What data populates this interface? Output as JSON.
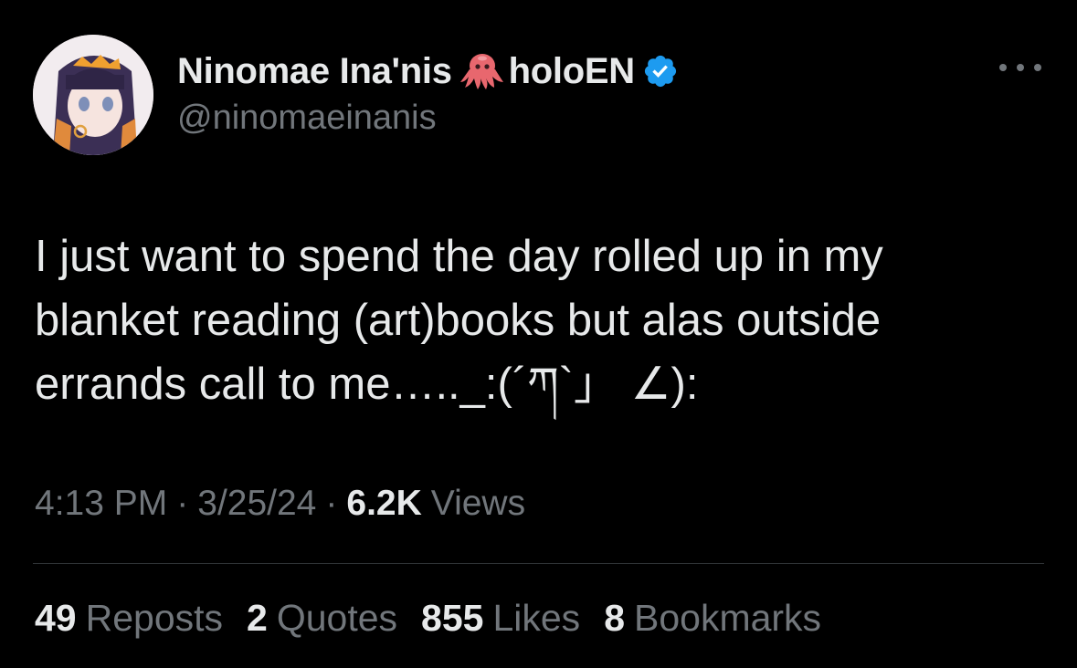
{
  "author": {
    "display_name": "Ninomae Ina'nis",
    "display_suffix": "holoEN",
    "handle": "@ninomaeinanis",
    "badge_icon": "octopus-icon",
    "verified": true,
    "verified_color": "#1d9bf0"
  },
  "tweet": {
    "lines": [
      "I just want to spend the day rolled up in my",
      "blanket reading (art)books but alas outside",
      "errands call to me….._:(´ཀ`」 ∠):"
    ]
  },
  "meta": {
    "time": "4:13 PM",
    "separator": "·",
    "date": "3/25/24",
    "views_count": "6.2K",
    "views_label": "Views"
  },
  "stats": {
    "reposts": {
      "count": "49",
      "label": "Reposts"
    },
    "quotes": {
      "count": "2",
      "label": "Quotes"
    },
    "likes": {
      "count": "855",
      "label": "Likes"
    },
    "bookmarks": {
      "count": "8",
      "label": "Bookmarks"
    }
  },
  "colors": {
    "background": "#000000",
    "primary_text": "#e7e9ea",
    "secondary_text": "#71767b",
    "divider": "#2f3336"
  }
}
